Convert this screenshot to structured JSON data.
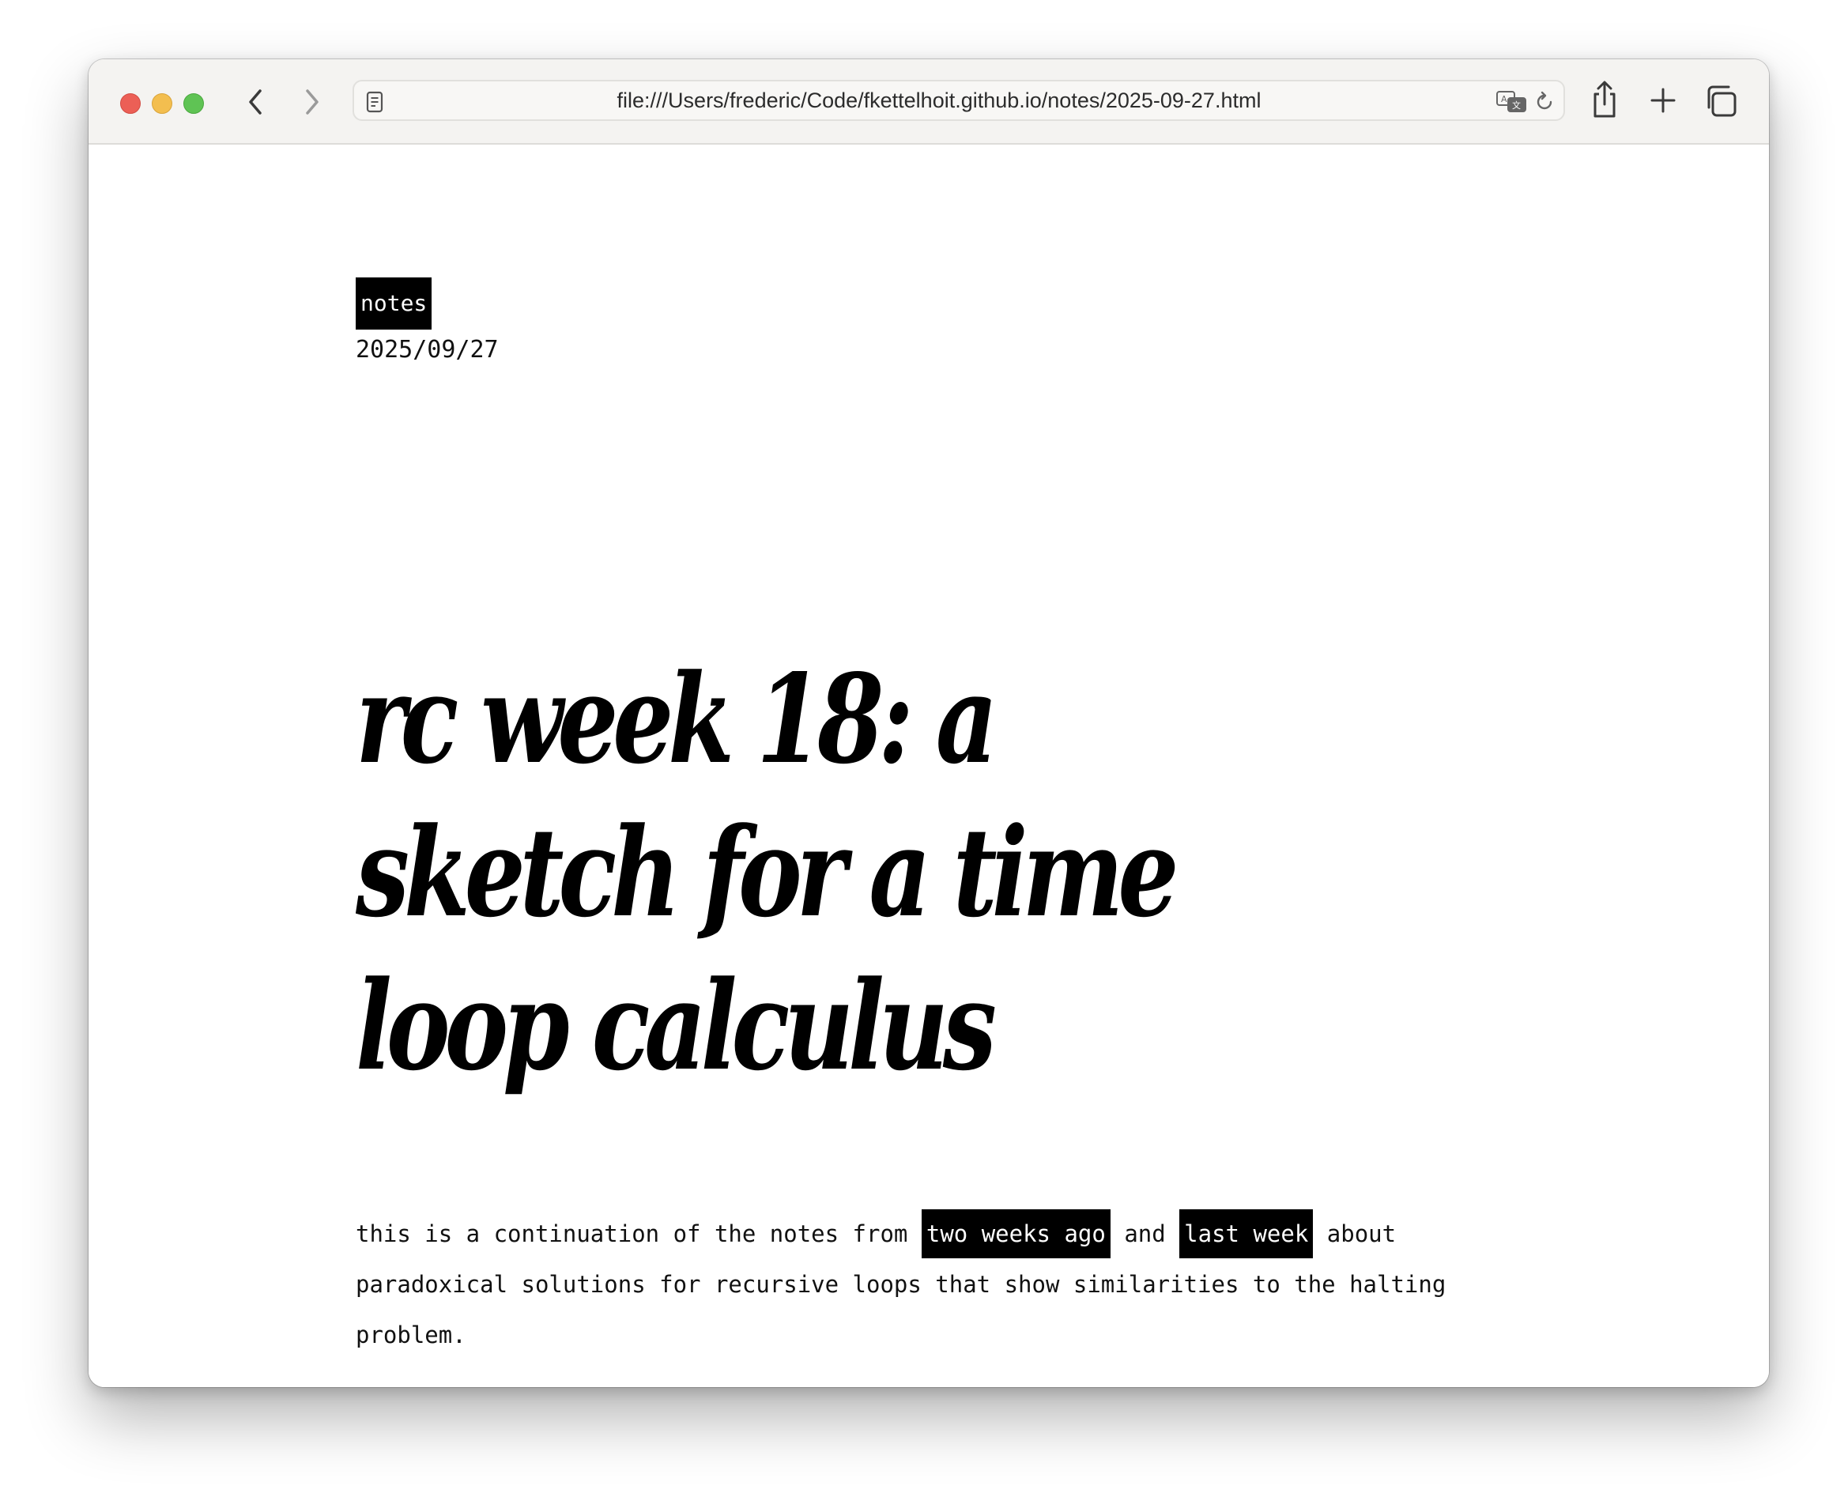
{
  "browser": {
    "url": "file:///Users/frederic/Code/fkettelhoit.github.io/notes/2025-09-27.html",
    "icons": {
      "back": "chevron-left-icon",
      "forward": "chevron-right-icon",
      "reader": "page-icon",
      "translate": "translate-icon",
      "reload": "reload-icon",
      "share": "share-icon",
      "new_tab": "plus-icon",
      "tabs": "tab-overview-icon"
    },
    "traffic_lights": {
      "close": "#ec5f56",
      "minimize": "#f3be4f",
      "zoom": "#5fc354"
    }
  },
  "page": {
    "tag": "notes",
    "date": "2025/09/27",
    "title": "rc week 18: a sketch for a time loop calculus",
    "intro": {
      "before": "this is a continuation of the notes from",
      "link1": "two weeks ago",
      "middle": "and",
      "link2": "last week",
      "after": "about paradoxical solutions for recursive loops that show similarities to the halting problem."
    }
  }
}
